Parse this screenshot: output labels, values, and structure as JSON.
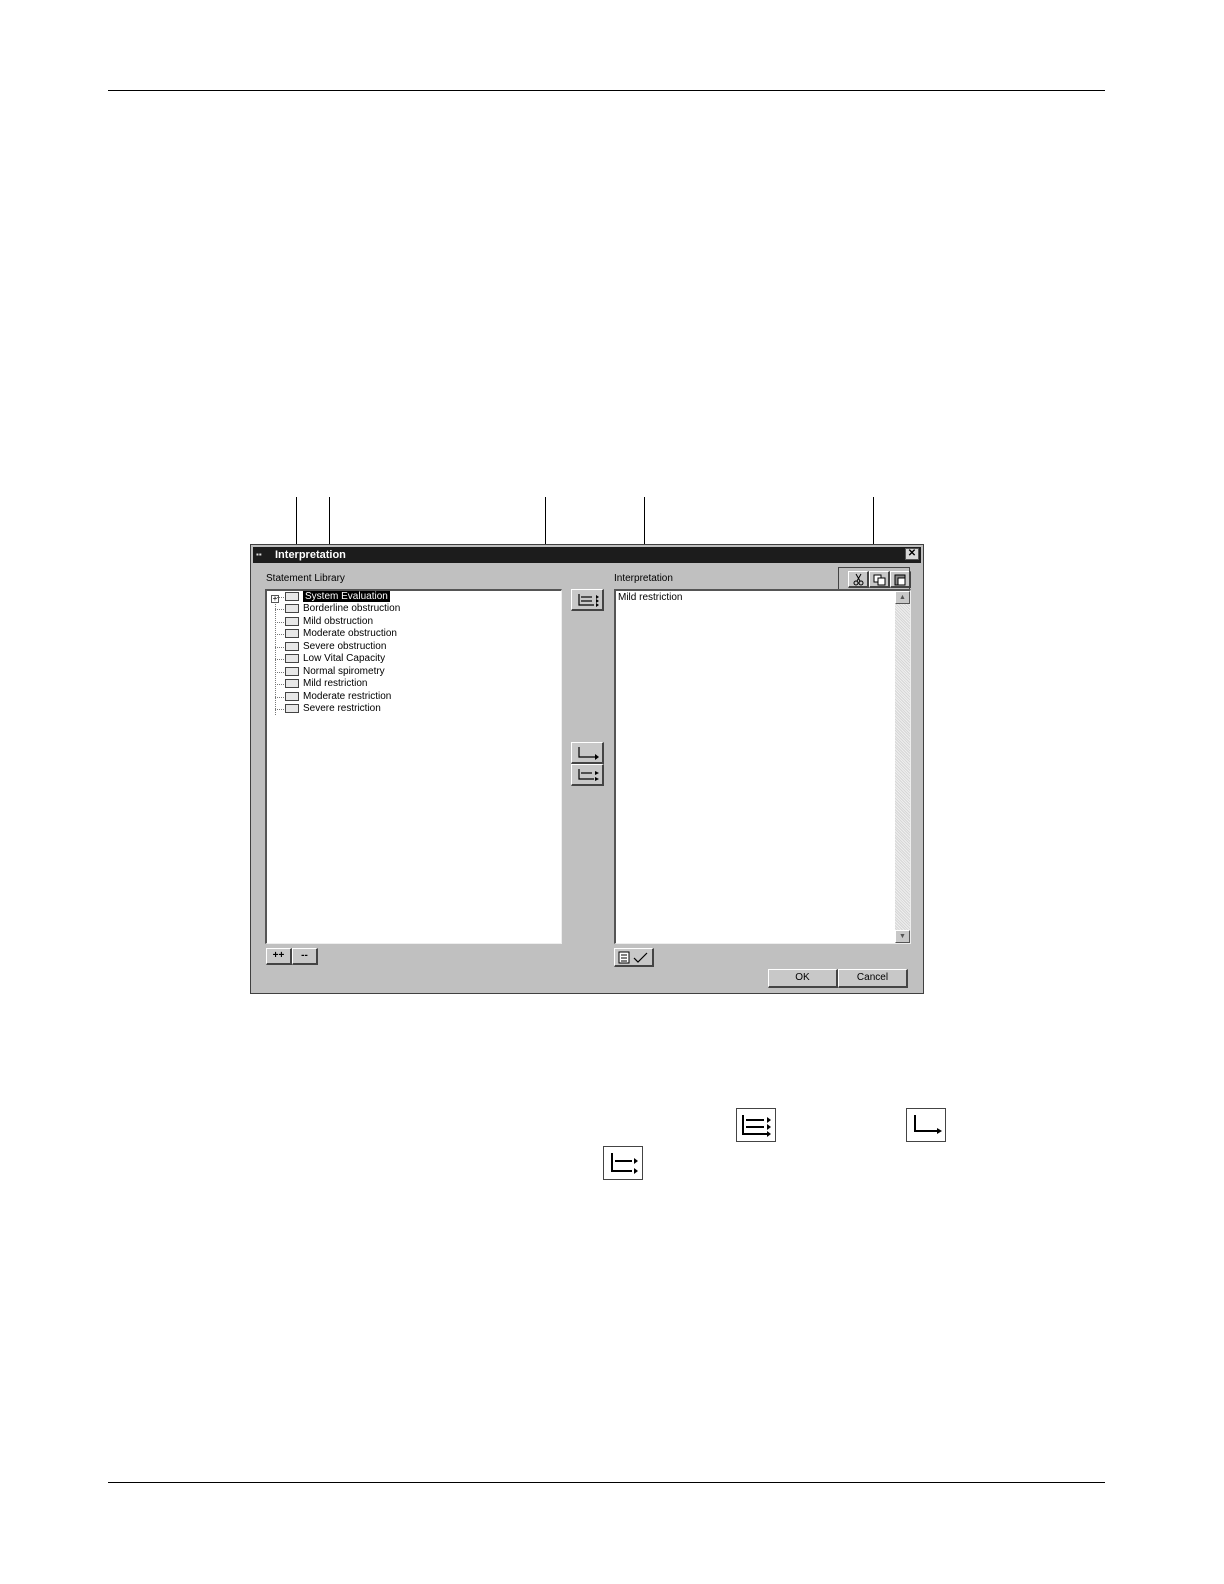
{
  "dialog": {
    "title": "Interpretation",
    "close_label": "✕",
    "statement_library_label": "Statement Library",
    "interpretation_label": "Interpretation",
    "tree": {
      "expander": "+",
      "items": [
        {
          "label": "System Evaluation",
          "selected": true
        },
        {
          "label": "Borderline obstruction"
        },
        {
          "label": "Mild obstruction"
        },
        {
          "label": "Moderate obstruction"
        },
        {
          "label": "Severe obstruction"
        },
        {
          "label": "Low Vital Capacity"
        },
        {
          "label": "Normal spirometry"
        },
        {
          "label": "Mild restriction"
        },
        {
          "label": "Moderate restriction"
        },
        {
          "label": "Severe restriction"
        }
      ]
    },
    "interpretation_text": "Mild restriction",
    "expand_all_label": "++",
    "collapse_all_label": "--",
    "ok_label": "OK",
    "cancel_label": "Cancel",
    "toolbar_icons": [
      "cut-icon",
      "copy-icon",
      "paste-icon"
    ],
    "scroll_up": "▲",
    "scroll_down": "▼"
  }
}
